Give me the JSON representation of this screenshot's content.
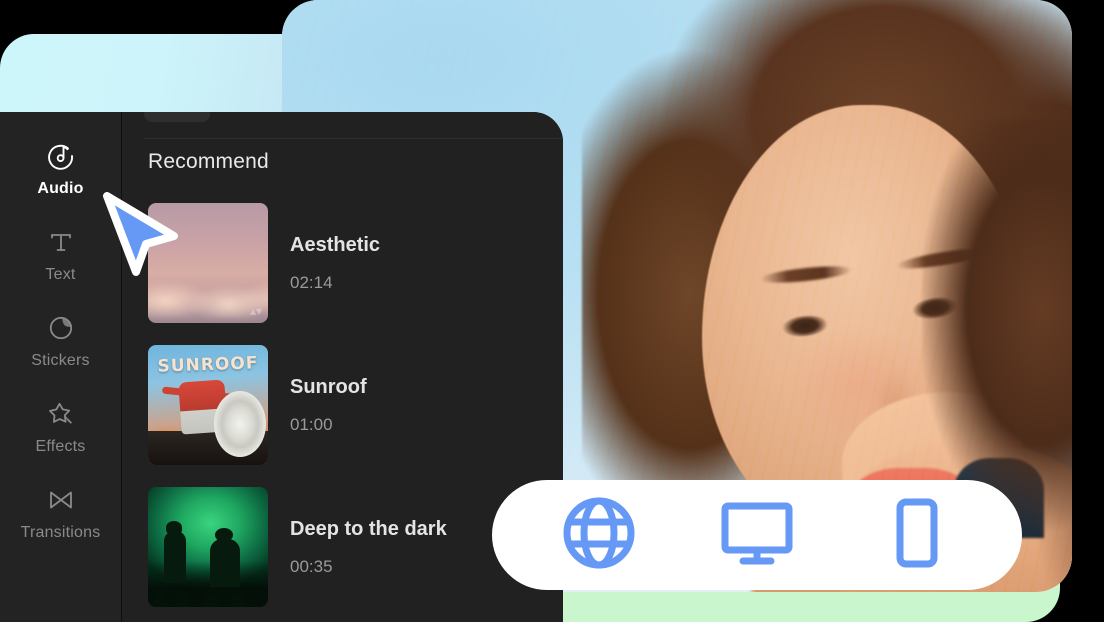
{
  "app": {
    "panel_title": "Recommend"
  },
  "sidebar": {
    "items": [
      {
        "label": "Audio",
        "icon": "audio-icon",
        "active": true
      },
      {
        "label": "Text",
        "icon": "text-icon",
        "active": false
      },
      {
        "label": "Stickers",
        "icon": "stickers-icon",
        "active": false
      },
      {
        "label": "Effects",
        "icon": "effects-icon",
        "active": false
      },
      {
        "label": "Transitions",
        "icon": "transitions-icon",
        "active": false
      }
    ]
  },
  "tracks": [
    {
      "name": "Aesthetic",
      "duration": "02:14",
      "art": "sunset-clouds"
    },
    {
      "name": "Sunroof",
      "duration": "01:00",
      "art": "sunroof-album",
      "art_text": "SUNROOF"
    },
    {
      "name": "Deep to the dark",
      "duration": "00:35",
      "art": "green-concert"
    }
  ],
  "device_bar": {
    "buttons": [
      {
        "icon": "globe-icon"
      },
      {
        "icon": "desktop-monitor-icon"
      },
      {
        "icon": "mobile-phone-icon"
      }
    ]
  },
  "colors": {
    "accent_blue": "#6699f5",
    "panel_bg": "#212121",
    "rail_bg": "#232323",
    "deco_cyan": "#cdf6fb",
    "deco_green": "#c9f6cd",
    "text_primary": "#e9e9e9",
    "text_muted": "#9a9a9a"
  }
}
